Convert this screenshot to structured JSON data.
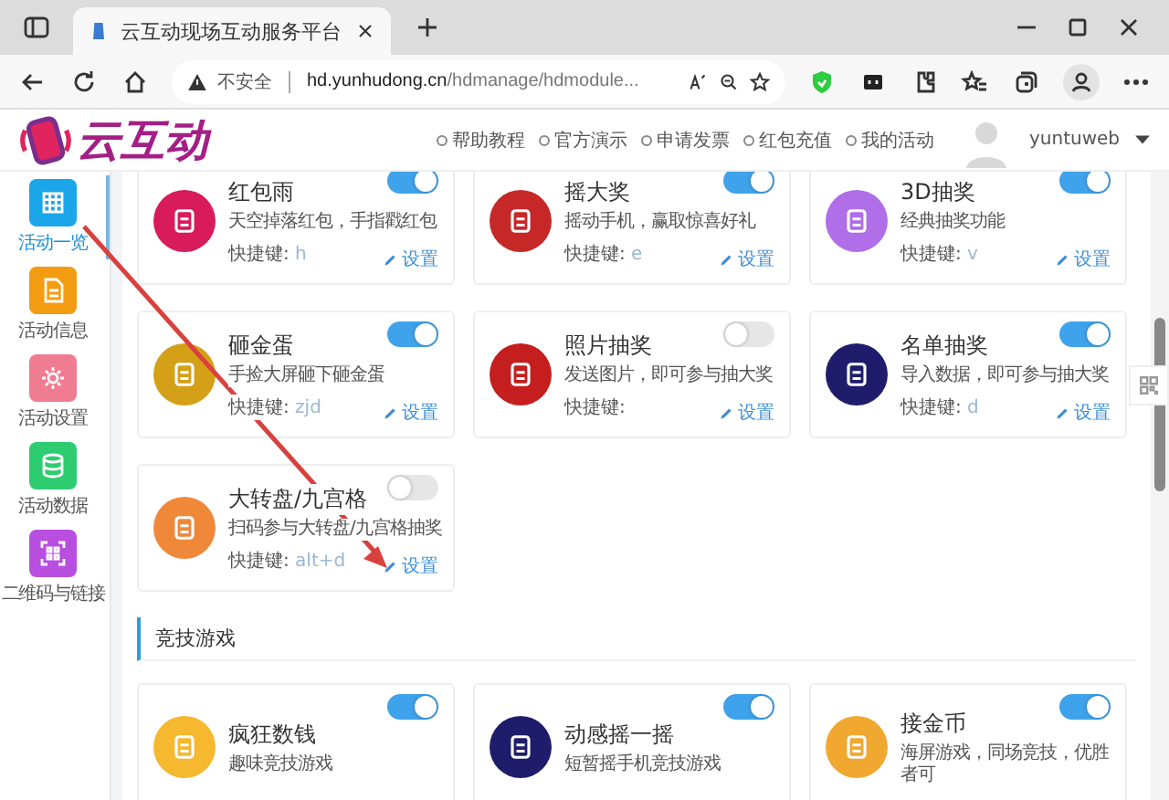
{
  "browser": {
    "tab_title": "云互动现场互动服务平台",
    "security": "不安全",
    "url_host": "hd.yunhudong.cn",
    "url_path": "/hdmanage/hdmodule..."
  },
  "header": {
    "logo": "云互动",
    "nav": [
      "帮助教程",
      "官方演示",
      "申请发票",
      "红包充值",
      "我的活动"
    ],
    "user": "yuntuweb"
  },
  "sidebar": {
    "items": [
      {
        "label": "活动一览",
        "selected": true,
        "color": "#1aa6e8"
      },
      {
        "label": "活动信息",
        "selected": false,
        "color": "#f39c12"
      },
      {
        "label": "活动设置",
        "selected": false,
        "color": "#f07c91"
      },
      {
        "label": "活动数据",
        "selected": false,
        "color": "#2ecc71"
      },
      {
        "label": "二维码与链接",
        "selected": false,
        "color": "#b84fe0"
      }
    ]
  },
  "modules": [
    {
      "title": "红包雨",
      "desc": "天空掉落红包，手指戳红包",
      "shortcut_label": "快捷键:",
      "shortcut": "h",
      "on": true,
      "color": "#d81b5a",
      "action": "设置"
    },
    {
      "title": "摇大奖",
      "desc": "摇动手机，赢取惊喜好礼",
      "shortcut_label": "快捷键:",
      "shortcut": "e",
      "on": true,
      "color": "#c62828",
      "action": "设置"
    },
    {
      "title": "3D抽奖",
      "desc": "经典抽奖功能",
      "shortcut_label": "快捷键:",
      "shortcut": "v",
      "on": true,
      "color": "#b06ee8",
      "action": "设置"
    },
    {
      "title": "砸金蛋",
      "desc": "手捡大屏砸下砸金蛋",
      "shortcut_label": "快捷键:",
      "shortcut": "zjd",
      "on": true,
      "color": "#d4a017",
      "action": "设置"
    },
    {
      "title": "照片抽奖",
      "desc": "发送图片，即可参与抽大奖",
      "shortcut_label": "快捷键:",
      "on": false,
      "color": "#c41e1e",
      "action": "设置"
    },
    {
      "title": "名单抽奖",
      "desc": "导入数据，即可参与抽大奖",
      "shortcut_label": "快捷键:",
      "shortcut": "d",
      "on": true,
      "color": "#1f1d6b",
      "action": "设置"
    },
    {
      "title": "大转盘/九宫格",
      "desc": "扫码参与大转盘/九宫格抽奖",
      "shortcut_label": "快捷键:",
      "shortcut": "alt+d",
      "on": false,
      "color": "#f0883a",
      "action": "设置"
    }
  ],
  "section": {
    "title": "竞技游戏",
    "modules": [
      {
        "title": "疯狂数钱",
        "desc": "趣味竞技游戏",
        "on": true,
        "color": "#f5b82e"
      },
      {
        "title": "动感摇一摇",
        "desc": "短暂摇手机竞技游戏",
        "on": true,
        "color": "#1f1d6b"
      },
      {
        "title": "接金币",
        "desc": "海屏游戏，同场竞技，优胜者可",
        "on": true,
        "color": "#f0a830"
      }
    ]
  }
}
